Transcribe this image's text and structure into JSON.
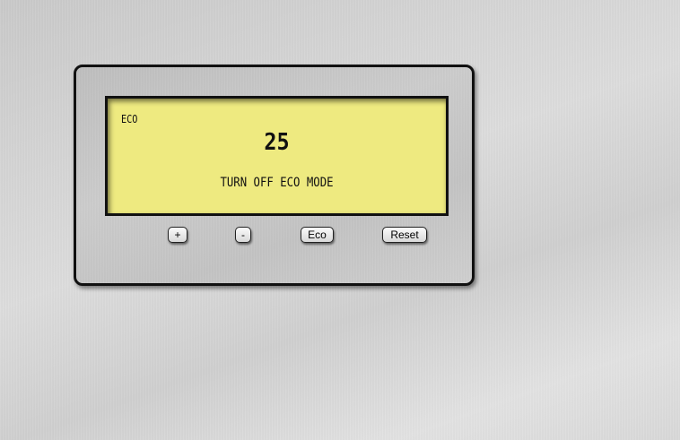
{
  "display": {
    "mode_indicator": "ECO",
    "value": "25",
    "message": "TURN OFF ECO MODE"
  },
  "controls": {
    "plus_label": "+",
    "minus_label": "-",
    "eco_label": "Eco",
    "reset_label": "Reset"
  },
  "colors": {
    "lcd_background": "#eeea80",
    "panel_border": "#111111"
  }
}
